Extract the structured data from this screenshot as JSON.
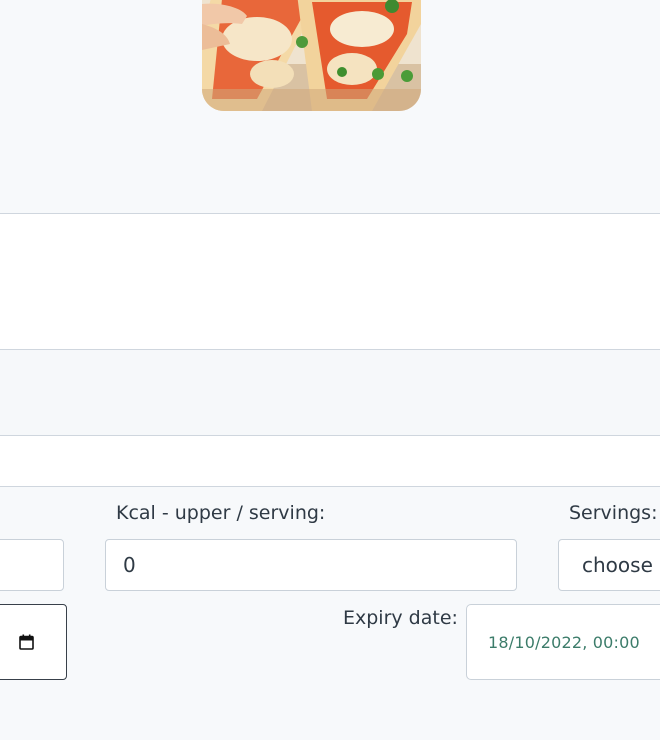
{
  "form": {
    "kcal_upper_label": "Kcal - upper / serving:",
    "kcal_upper_value": "0",
    "servings_label": "Servings:",
    "servings_selected": "choose",
    "expiry_label": "Expiry date:",
    "expiry_value": "18/10/2022, 00:00"
  },
  "icons": {
    "calendar": "calendar-icon"
  }
}
